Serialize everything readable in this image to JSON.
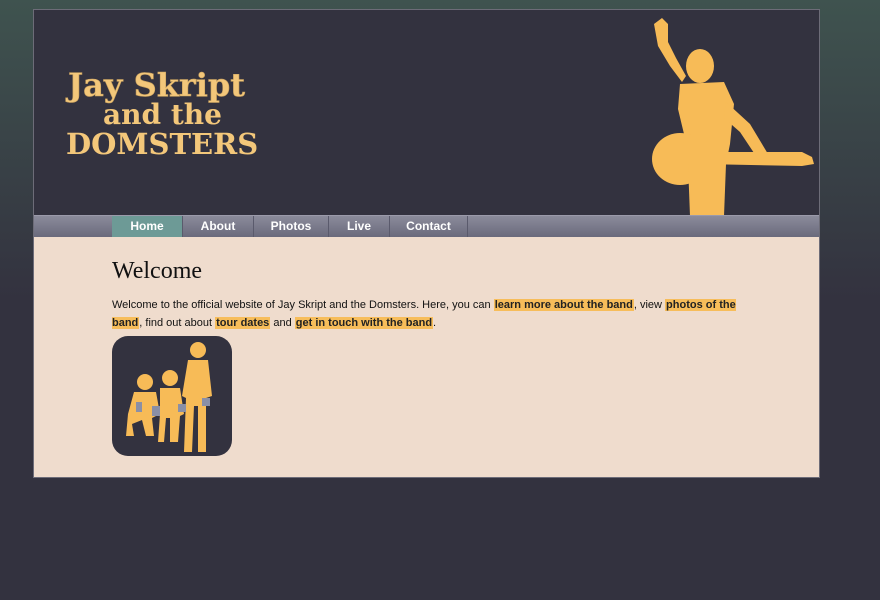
{
  "site": {
    "logo_line1": "Jay Skript",
    "logo_line2": "and the",
    "logo_line3": "DOMSTERS"
  },
  "nav": {
    "items": [
      {
        "label": "Home",
        "active": true
      },
      {
        "label": "About",
        "active": false
      },
      {
        "label": "Photos",
        "active": false
      },
      {
        "label": "Live",
        "active": false
      },
      {
        "label": "Contact",
        "active": false
      }
    ]
  },
  "content": {
    "heading": "Welcome",
    "intro_1": "Welcome to the official website of Jay Skript and the Domsters. Here, you can ",
    "link_about": "learn more about the band",
    "intro_2": ", view ",
    "link_photos": "photos of the band",
    "intro_3": ", find out about ",
    "link_tour": "tour dates",
    "intro_4": " and ",
    "link_contact": "get in touch with the band",
    "intro_5": "."
  },
  "colors": {
    "accent": "#f7bd5a",
    "dark": "#33323f",
    "nav_active": "#6d9a96",
    "content_bg": "#efdccd"
  },
  "icons": [
    "guitarist-silhouette",
    "band-silhouette"
  ]
}
